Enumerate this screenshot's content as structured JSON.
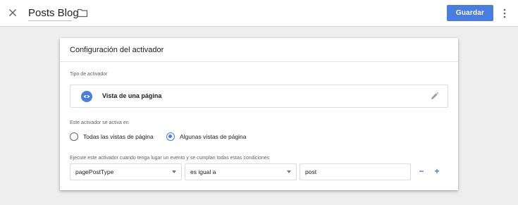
{
  "header": {
    "title": "Posts Blog",
    "save_label": "Guardar",
    "close_icon": "close-icon",
    "folder_icon": "folder-icon",
    "more_icon": "more-vert-icon"
  },
  "card": {
    "title": "Configuración del activador",
    "trigger_type_label": "Tipo de activador",
    "trigger_type": {
      "name": "Vista de una página",
      "icon": "eye-icon",
      "edit_icon": "pencil-icon"
    },
    "fires_on_label": "Este activador se activa en",
    "fires_on_options": [
      {
        "label": "Todas las vistas de página",
        "checked": false
      },
      {
        "label": "Algunas vistas de página",
        "checked": true
      }
    ],
    "conditions_label": "Ejecute este activador cuando tenga lugar un evento y se cumplan todas estas condiciones",
    "condition": {
      "variable": "pagePostType",
      "operator": "es igual a",
      "value": "post"
    },
    "remove_label": "−",
    "add_label": "+"
  },
  "colors": {
    "accent": "#4a7de0",
    "background": "#eeeeee"
  }
}
